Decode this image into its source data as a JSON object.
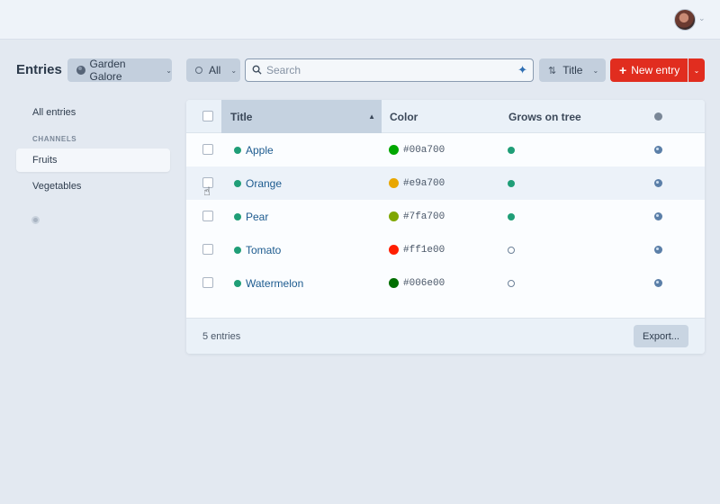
{
  "header": {
    "page_title": "Entries",
    "site_selector": "Garden Galore",
    "status_filter": "All",
    "search": {
      "placeholder": "Search",
      "value": ""
    },
    "sort_label": "Title",
    "new_entry_label": "New entry"
  },
  "sidebar": {
    "all_entries": "All entries",
    "channels_heading": "CHANNELS",
    "items": [
      {
        "label": "Fruits",
        "active": true
      },
      {
        "label": "Vegetables",
        "active": false
      }
    ]
  },
  "table": {
    "columns": [
      "Title",
      "Color",
      "Grows on tree"
    ],
    "sort_direction": "ascending",
    "rows": [
      {
        "title": "Apple",
        "color": "#00a700",
        "grows_on_tree": true
      },
      {
        "title": "Orange",
        "color": "#e9a700",
        "grows_on_tree": true
      },
      {
        "title": "Pear",
        "color": "#7fa700",
        "grows_on_tree": true
      },
      {
        "title": "Tomato",
        "color": "#ff1e00",
        "grows_on_tree": false
      },
      {
        "title": "Watermelon",
        "color": "#006e00",
        "grows_on_tree": false
      }
    ],
    "count_label": "5 entries",
    "export_label": "Export..."
  },
  "colors": {
    "accent": "#e12d1f",
    "link": "#1d5b8f",
    "status_enabled": "#1f9e77"
  }
}
